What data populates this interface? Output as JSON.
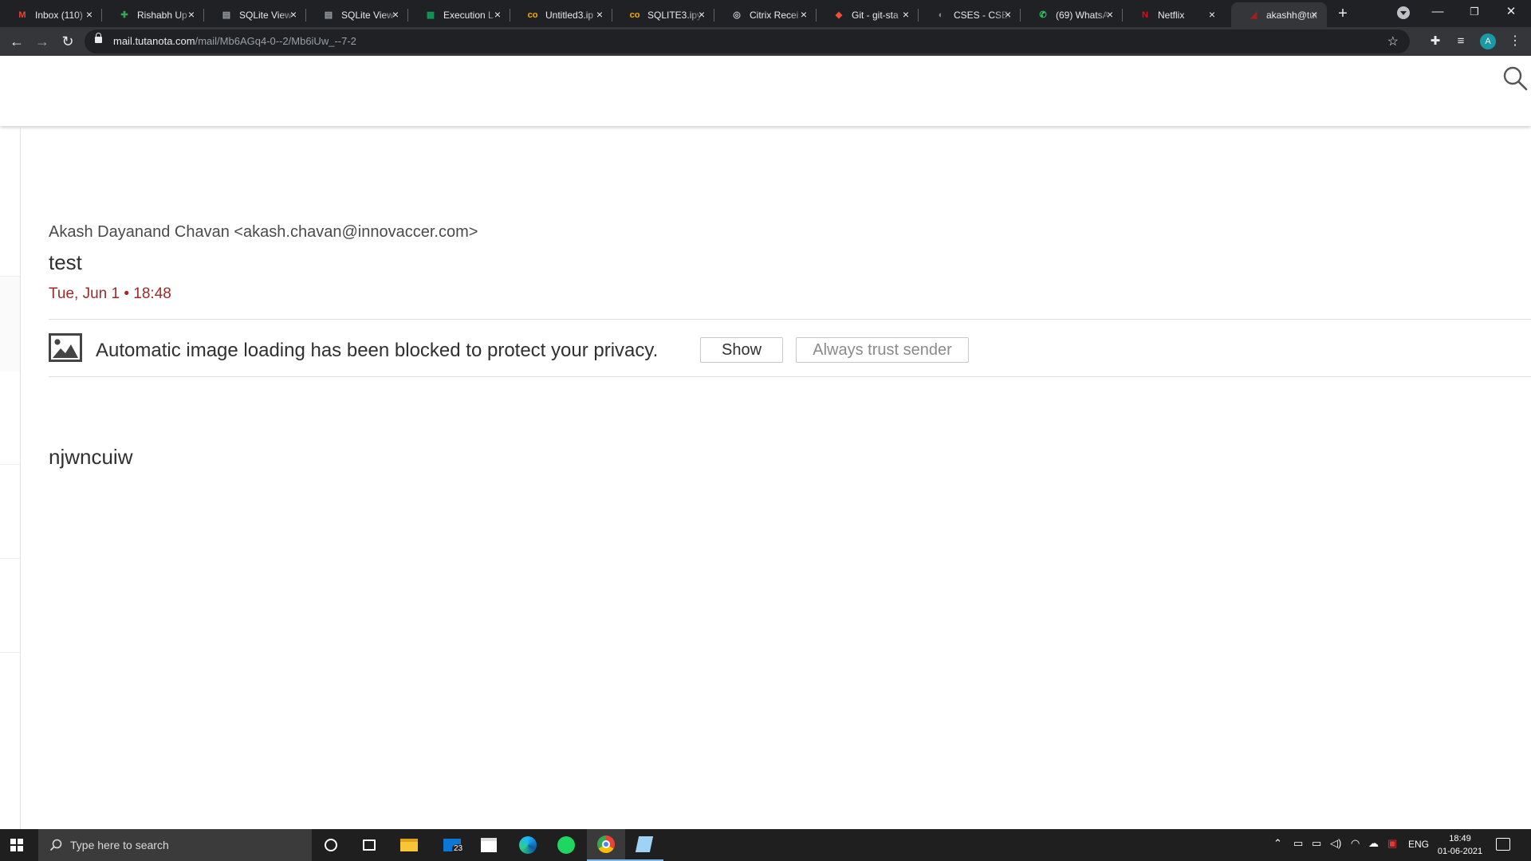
{
  "browser": {
    "tabs": [
      {
        "title": "Inbox (110)",
        "icon": "gmail-icon",
        "color": "#ea4335",
        "glyph": "M"
      },
      {
        "title": "Rishabh Up",
        "icon": "puzzle-icon",
        "color": "#34a853",
        "glyph": "✚"
      },
      {
        "title": "SQLite View",
        "icon": "database-icon",
        "color": "#9aa0a6",
        "glyph": "▤"
      },
      {
        "title": "SQLite View",
        "icon": "database-icon",
        "color": "#9aa0a6",
        "glyph": "▤"
      },
      {
        "title": "Execution L",
        "icon": "sheets-icon",
        "color": "#0f9d58",
        "glyph": "▦"
      },
      {
        "title": "Untitled3.ip",
        "icon": "colab-icon",
        "color": "#f9ab00",
        "glyph": "co"
      },
      {
        "title": "SQLITE3.ipy",
        "icon": "colab-icon",
        "color": "#f9ab00",
        "glyph": "co"
      },
      {
        "title": "Citrix Recei",
        "icon": "citrix-icon",
        "color": "#bdc1c6",
        "glyph": "◎"
      },
      {
        "title": "Git - git-sta",
        "icon": "git-icon",
        "color": "#f05133",
        "glyph": "◆"
      },
      {
        "title": "CSES - CSES",
        "icon": "cses-icon",
        "color": "#80868b",
        "glyph": "◐"
      },
      {
        "title": "(69) WhatsA",
        "icon": "whatsapp-icon",
        "color": "#25d366",
        "glyph": "✆"
      },
      {
        "title": "Netflix",
        "icon": "netflix-icon",
        "color": "#e50914",
        "glyph": "N"
      },
      {
        "title": "akashh@tut",
        "icon": "tutanota-icon",
        "color": "#a01e20",
        "glyph": "◢"
      }
    ],
    "url_host": "mail.tutanota.com",
    "url_path": "/mail/Mb6AGq4-0--2/Mb6iUw_--7-2",
    "profile_initial": "A"
  },
  "mail": {
    "sender": "Akash Dayanand Chavan <akash.chavan@innovaccer.com>",
    "subject": "test",
    "date": "Tue, Jun 1 • 18:48",
    "image_notice": "Automatic image loading has been blocked to protect your privacy.",
    "show_label": "Show",
    "trust_label": "Always trust sender",
    "body": "njwncuiw"
  },
  "taskbar": {
    "search_placeholder": "Type here to search",
    "mail_badge": "23",
    "language": "ENG",
    "time": "18:49",
    "date": "01-06-2021"
  },
  "colors": {
    "accent": "#a01e20",
    "date_text": "#9c2a2a",
    "chrome_dark": "#202124"
  }
}
